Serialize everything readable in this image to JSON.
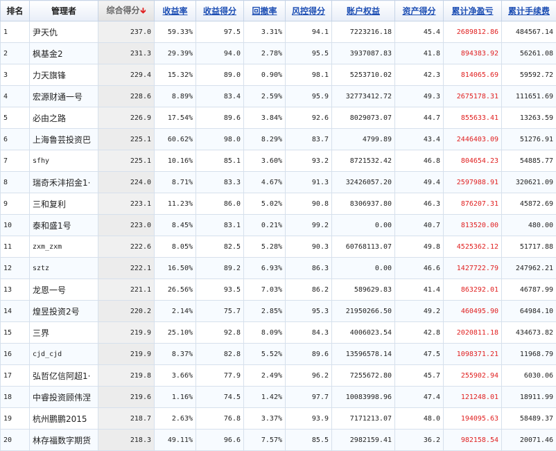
{
  "colors": {
    "link_header": "#1e4fb4",
    "profit_red": "#e02020",
    "sort_arrow": "#e02020"
  },
  "headers": {
    "rank": "排名",
    "manager": "管理者",
    "composite_score": "综合得分",
    "return_rate": "收益率",
    "return_score": "收益得分",
    "drawdown": "回撤率",
    "risk_score": "风控得分",
    "equity": "账户权益",
    "asset_score": "资产得分",
    "net_profit": "累计净盈亏",
    "fees": "累计手续费",
    "sort_arrow_icon": "arrow-down-icon"
  },
  "rows": [
    {
      "rank": "1",
      "name": "尹天仇",
      "score": "237.0",
      "ret": "59.33%",
      "rets": "97.5",
      "dd": "3.31%",
      "risk": "94.1",
      "equity": "7223216.18",
      "asset": "45.4",
      "profit": "2689812.86",
      "fee": "484567.14"
    },
    {
      "rank": "2",
      "name": "枫基金2",
      "score": "231.3",
      "ret": "29.39%",
      "rets": "94.0",
      "dd": "2.78%",
      "risk": "95.5",
      "equity": "3937087.83",
      "asset": "41.8",
      "profit": "894383.92",
      "fee": "56261.08"
    },
    {
      "rank": "3",
      "name": "力天旗锋",
      "score": "229.4",
      "ret": "15.32%",
      "rets": "89.0",
      "dd": "0.90%",
      "risk": "98.1",
      "equity": "5253710.02",
      "asset": "42.3",
      "profit": "814065.69",
      "fee": "59592.72"
    },
    {
      "rank": "4",
      "name": "宏源财通一号",
      "score": "228.6",
      "ret": "8.89%",
      "rets": "83.4",
      "dd": "2.59%",
      "risk": "95.9",
      "equity": "32773412.72",
      "asset": "49.3",
      "profit": "2675178.31",
      "fee": "111651.69"
    },
    {
      "rank": "5",
      "name": "必由之路",
      "score": "226.9",
      "ret": "17.54%",
      "rets": "89.6",
      "dd": "3.84%",
      "risk": "92.6",
      "equity": "8029073.07",
      "asset": "44.7",
      "profit": "855633.41",
      "fee": "13263.59"
    },
    {
      "rank": "6",
      "name": "上海鲁芸投资巴",
      "score": "225.1",
      "ret": "60.62%",
      "rets": "98.0",
      "dd": "8.29%",
      "risk": "83.7",
      "equity": "4799.89",
      "asset": "43.4",
      "profit": "2446403.09",
      "fee": "51276.91"
    },
    {
      "rank": "7",
      "name": "sfhy",
      "score": "225.1",
      "ret": "10.16%",
      "rets": "85.1",
      "dd": "3.60%",
      "risk": "93.2",
      "equity": "8721532.42",
      "asset": "46.8",
      "profit": "804654.23",
      "fee": "54885.77"
    },
    {
      "rank": "8",
      "name": "瑞奇禾沣招金1·",
      "score": "224.0",
      "ret": "8.71%",
      "rets": "83.3",
      "dd": "4.67%",
      "risk": "91.3",
      "equity": "32426057.20",
      "asset": "49.4",
      "profit": "2597988.91",
      "fee": "320621.09"
    },
    {
      "rank": "9",
      "name": "三和复利",
      "score": "223.1",
      "ret": "11.23%",
      "rets": "86.0",
      "dd": "5.02%",
      "risk": "90.8",
      "equity": "8306937.80",
      "asset": "46.3",
      "profit": "876207.31",
      "fee": "45872.69"
    },
    {
      "rank": "10",
      "name": "泰和盛1号",
      "score": "223.0",
      "ret": "8.45%",
      "rets": "83.1",
      "dd": "0.21%",
      "risk": "99.2",
      "equity": "0.00",
      "asset": "40.7",
      "profit": "813520.00",
      "fee": "480.00"
    },
    {
      "rank": "11",
      "name": "zxm_zxm",
      "score": "222.6",
      "ret": "8.05%",
      "rets": "82.5",
      "dd": "5.28%",
      "risk": "90.3",
      "equity": "60768113.07",
      "asset": "49.8",
      "profit": "4525362.12",
      "fee": "51717.88"
    },
    {
      "rank": "12",
      "name": "sztz",
      "score": "222.1",
      "ret": "16.50%",
      "rets": "89.2",
      "dd": "6.93%",
      "risk": "86.3",
      "equity": "0.00",
      "asset": "46.6",
      "profit": "1427722.79",
      "fee": "247962.21"
    },
    {
      "rank": "13",
      "name": "龙恩一号",
      "score": "221.1",
      "ret": "26.56%",
      "rets": "93.5",
      "dd": "7.03%",
      "risk": "86.2",
      "equity": "589629.83",
      "asset": "41.4",
      "profit": "863292.01",
      "fee": "46787.99"
    },
    {
      "rank": "14",
      "name": "煌昱投资2号",
      "score": "220.2",
      "ret": "2.14%",
      "rets": "75.7",
      "dd": "2.85%",
      "risk": "95.3",
      "equity": "21950266.50",
      "asset": "49.2",
      "profit": "460495.90",
      "fee": "64984.10"
    },
    {
      "rank": "15",
      "name": "三界",
      "score": "219.9",
      "ret": "25.10%",
      "rets": "92.8",
      "dd": "8.09%",
      "risk": "84.3",
      "equity": "4006023.54",
      "asset": "42.8",
      "profit": "2020811.18",
      "fee": "434673.82"
    },
    {
      "rank": "16",
      "name": "cjd_cjd",
      "score": "219.9",
      "ret": "8.37%",
      "rets": "82.8",
      "dd": "5.52%",
      "risk": "89.6",
      "equity": "13596578.14",
      "asset": "47.5",
      "profit": "1098371.21",
      "fee": "11968.79"
    },
    {
      "rank": "17",
      "name": "弘哲亿信阿超1·",
      "score": "219.8",
      "ret": "3.66%",
      "rets": "77.9",
      "dd": "2.49%",
      "risk": "96.2",
      "equity": "7255672.80",
      "asset": "45.7",
      "profit": "255902.94",
      "fee": "6030.06"
    },
    {
      "rank": "18",
      "name": "中睿投资顾伟涅",
      "score": "219.6",
      "ret": "1.16%",
      "rets": "74.5",
      "dd": "1.42%",
      "risk": "97.7",
      "equity": "10083998.96",
      "asset": "47.4",
      "profit": "121248.01",
      "fee": "18911.99"
    },
    {
      "rank": "19",
      "name": "杭州鹏鹏2015",
      "score": "218.7",
      "ret": "2.63%",
      "rets": "76.8",
      "dd": "3.37%",
      "risk": "93.9",
      "equity": "7171213.07",
      "asset": "48.0",
      "profit": "194095.63",
      "fee": "58489.37"
    },
    {
      "rank": "20",
      "name": "林存福数字期货",
      "score": "218.3",
      "ret": "49.11%",
      "rets": "96.6",
      "dd": "7.57%",
      "risk": "85.5",
      "equity": "2982159.41",
      "asset": "36.2",
      "profit": "982158.54",
      "fee": "20071.46"
    }
  ]
}
